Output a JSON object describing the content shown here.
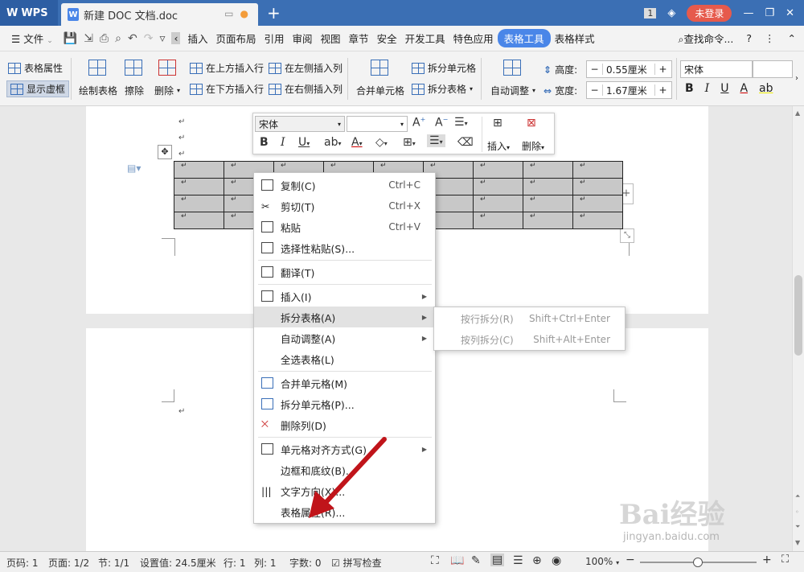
{
  "titlebar": {
    "app_name": "WPS",
    "doc_tab": "新建 DOC 文档.doc",
    "new_tab": "+",
    "page_badge": "1",
    "login": "未登录"
  },
  "menubar": {
    "file": "文件",
    "items": [
      "插入",
      "页面布局",
      "引用",
      "审阅",
      "视图",
      "章节",
      "安全",
      "开发工具",
      "特色应用",
      "表格工具",
      "表格样式"
    ],
    "active": "表格工具",
    "search": "查找命令..."
  },
  "ribbon": {
    "table_props": "表格属性",
    "show_gridlines": "显示虚框",
    "draw_table": "绘制表格",
    "erase": "擦除",
    "delete": "删除",
    "insert_above": "在上方插入行",
    "insert_below": "在下方插入行",
    "insert_left": "在左侧插入列",
    "insert_right": "在右侧插入列",
    "merge_cells": "合并单元格",
    "split_cells": "拆分单元格",
    "split_table": "拆分表格",
    "auto_fit": "自动调整",
    "height_label": "高度:",
    "height_value": "0.55厘米",
    "width_label": "宽度:",
    "width_value": "1.67厘米",
    "font_name": "宋体"
  },
  "float_toolbar": {
    "font": "宋体",
    "insert": "插入",
    "delete": "删除"
  },
  "context_menu": {
    "items": [
      {
        "label": "复制(C)",
        "shortcut": "Ctrl+C"
      },
      {
        "label": "剪切(T)",
        "shortcut": "Ctrl+X"
      },
      {
        "label": "粘贴",
        "shortcut": "Ctrl+V"
      },
      {
        "label": "选择性粘贴(S)...",
        "shortcut": ""
      },
      {
        "label": "翻译(T)",
        "shortcut": ""
      },
      {
        "label": "插入(I)",
        "shortcut": ""
      },
      {
        "label": "拆分表格(A)",
        "shortcut": ""
      },
      {
        "label": "自动调整(A)",
        "shortcut": ""
      },
      {
        "label": "全选表格(L)",
        "shortcut": ""
      },
      {
        "label": "合并单元格(M)",
        "shortcut": ""
      },
      {
        "label": "拆分单元格(P)...",
        "shortcut": ""
      },
      {
        "label": "删除列(D)",
        "shortcut": ""
      },
      {
        "label": "单元格对齐方式(G)",
        "shortcut": ""
      },
      {
        "label": "边框和底纹(B)...",
        "shortcut": ""
      },
      {
        "label": "文字方向(X)...",
        "shortcut": ""
      },
      {
        "label": "表格属性(R)...",
        "shortcut": ""
      }
    ]
  },
  "submenu": {
    "items": [
      {
        "label": "按行拆分(R)",
        "shortcut": "Shift+Ctrl+Enter"
      },
      {
        "label": "按列拆分(C)",
        "shortcut": "Shift+Alt+Enter"
      }
    ]
  },
  "table": {
    "rows": 4,
    "cols": 9,
    "cell_mark": "↵"
  },
  "statusbar": {
    "page_num": "页码: 1",
    "pages": "页面: 1/2",
    "section": "节: 1/1",
    "setting": "设置值: 24.5厘米",
    "row": "行: 1",
    "col": "列: 1",
    "words": "字数: 0",
    "spell": "拼写检查",
    "zoom": "100%"
  },
  "watermark": {
    "brand": "Bai经验",
    "url": "jingyan.baidu.com"
  },
  "colors": {
    "accent": "#4a86e8",
    "titlebar": "#3b6fb4",
    "arrow": "#c0141a"
  }
}
